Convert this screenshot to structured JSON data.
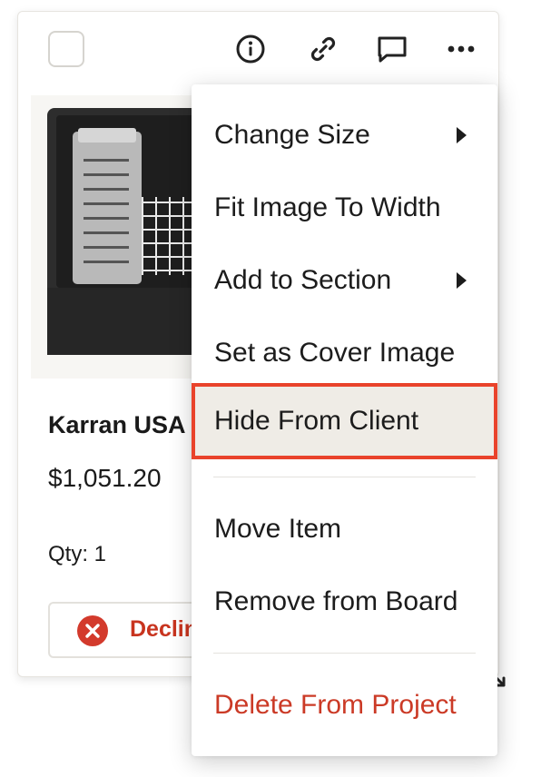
{
  "card": {
    "product_name": "Karran USA",
    "price": "$1,051.20",
    "qty": "Qty: 1",
    "decline_label": "Decline",
    "toolbar_icons": [
      "info-icon",
      "link-icon",
      "comment-icon",
      "more-icon"
    ]
  },
  "menu": {
    "change_size": "Change Size",
    "fit_image": "Fit Image To Width",
    "add_to_section": "Add to Section",
    "set_cover": "Set as Cover Image",
    "hide_from_client": "Hide From Client",
    "move_item": "Move Item",
    "remove_from_board": "Remove from Board",
    "delete_from_project": "Delete From Project"
  },
  "colors": {
    "danger": "#cb3a26",
    "highlight_bg": "#efece6",
    "highlight_outline": "#e9432b"
  }
}
